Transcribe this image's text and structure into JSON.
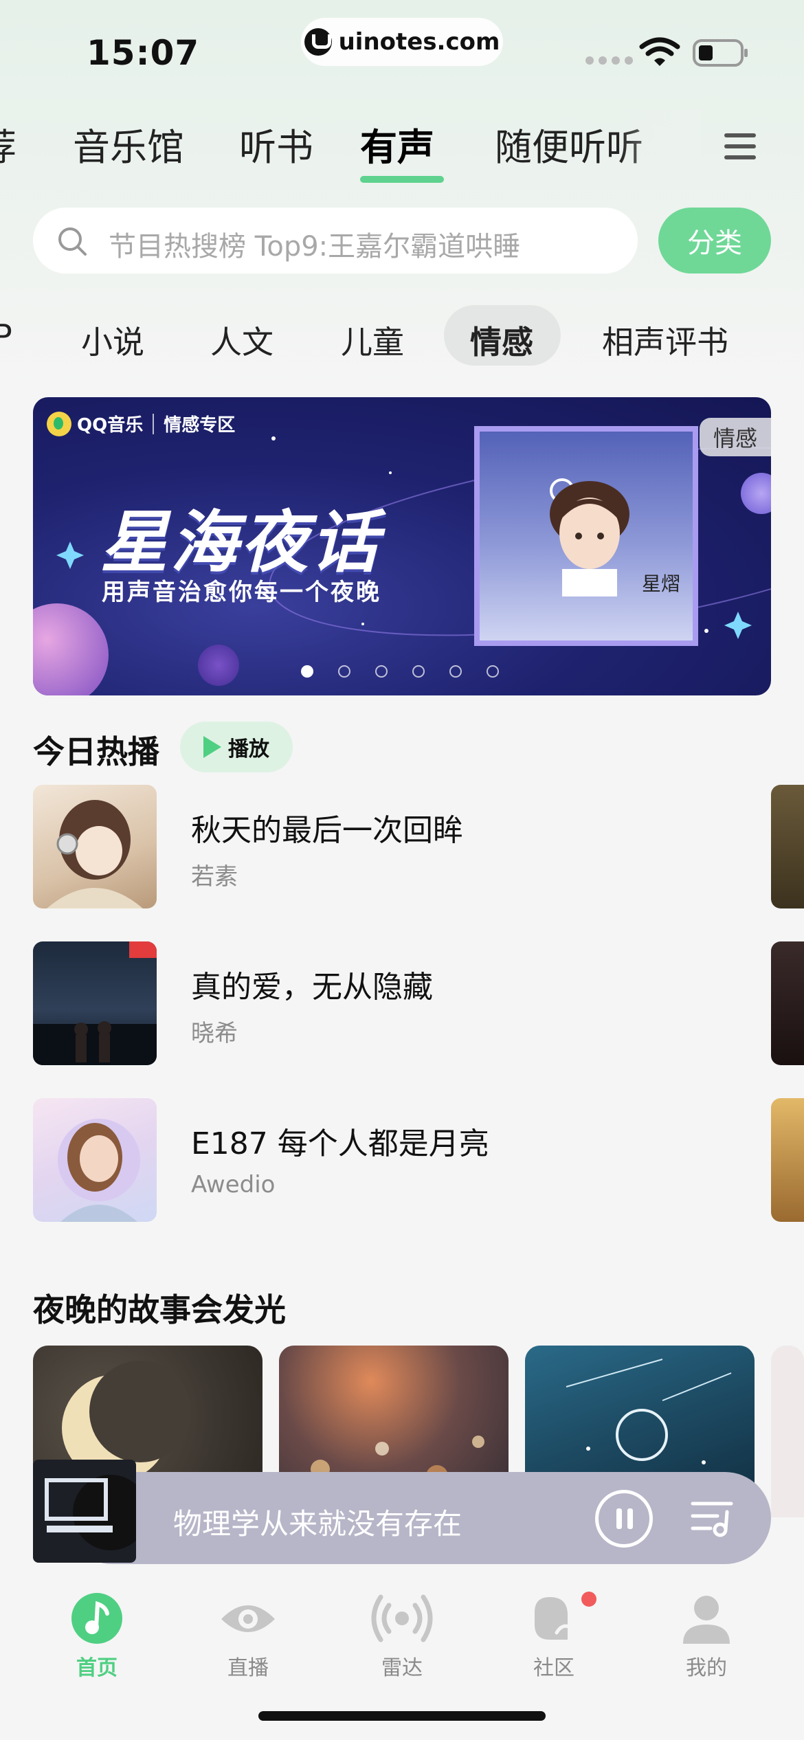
{
  "status_bar": {
    "time": "15:07",
    "url": "uinotes.com"
  },
  "top_tabs": [
    {
      "label": "荐"
    },
    {
      "label": "音乐馆"
    },
    {
      "label": "听书"
    },
    {
      "label": "有声",
      "active": true
    },
    {
      "label": "随便听听"
    }
  ],
  "search": {
    "placeholder": "节目热搜榜 Top9:王嘉尔霸道哄睡",
    "category_label": "分类"
  },
  "sub_tabs": [
    {
      "label": "P"
    },
    {
      "label": "小说"
    },
    {
      "label": "人文"
    },
    {
      "label": "儿童"
    },
    {
      "label": "情感",
      "active": true
    },
    {
      "label": "相声评书"
    }
  ],
  "banner": {
    "brand": "QQ音乐",
    "zone": "情感专区",
    "title": "星海夜话",
    "subtitle": "用声音治愈你每一个夜晚",
    "tag": "情感",
    "art_signature": "星熠",
    "page_count": 6,
    "active_index": 0
  },
  "today_hot": {
    "title": "今日热播",
    "play_label": "播放",
    "items": [
      {
        "title": "秋天的最后一次回眸",
        "author": "若素"
      },
      {
        "title": "真的爱，无从隐藏",
        "author": "晓希"
      },
      {
        "title": "E187 每个人都是月亮",
        "author": "Awedio"
      }
    ]
  },
  "night_section": {
    "title": "夜晚的故事会发光"
  },
  "mini_player": {
    "title": "物理学从来就没有存在"
  },
  "bottom_nav": [
    {
      "label": "首页",
      "icon": "music-note-icon",
      "active": true
    },
    {
      "label": "直播",
      "icon": "eye-icon"
    },
    {
      "label": "雷达",
      "icon": "radar-icon"
    },
    {
      "label": "社区",
      "icon": "community-icon",
      "badge": true
    },
    {
      "label": "我的",
      "icon": "profile-icon"
    }
  ],
  "colors": {
    "accent": "#5ed28e",
    "category_button": "#6fd897",
    "badge": "#f25b5b"
  }
}
